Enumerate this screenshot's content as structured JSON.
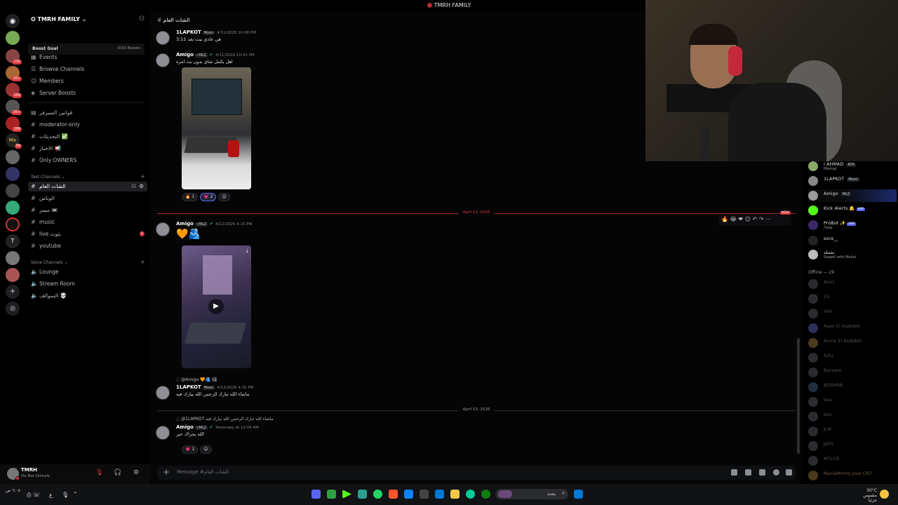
{
  "window": {
    "title": "TMRH FAMILY"
  },
  "server": {
    "name": "TMRH FAMILY",
    "boost_label": "Boost Goal",
    "boost_count": "0/33 Boosts",
    "rail_badges": [
      "130",
      "1K+",
      "100",
      "1K+",
      "108",
      "34"
    ],
    "rail_letters": [
      "Mx",
      "T"
    ]
  },
  "sidebar": {
    "top_items": [
      {
        "label": "Events",
        "icon": "calendar-icon"
      },
      {
        "label": "Browse Channels",
        "icon": "browse-icon"
      },
      {
        "label": "Members",
        "icon": "members-icon"
      },
      {
        "label": "Server Boosts",
        "icon": "boost-icon"
      }
    ],
    "channels_a": [
      {
        "label": "قوانين السيرفر",
        "icon": "rules-icon"
      },
      {
        "label": "moderator-only",
        "icon": "#"
      },
      {
        "label": "التحديثات ✅",
        "icon": "#"
      },
      {
        "label": "الاخبار 📢",
        "icon": "#"
      },
      {
        "label": "Only OWNERS",
        "icon": "#"
      }
    ],
    "text_category": "Text Channels",
    "text_channels": [
      {
        "label": "الشات العام",
        "icon": "#",
        "active": true
      },
      {
        "label": "الوناس",
        "icon": "#"
      },
      {
        "label": "ميمز 📼",
        "icon": "#"
      },
      {
        "label": "music",
        "icon": "#"
      },
      {
        "label": "live بثوث",
        "icon": "#",
        "unread": "1"
      },
      {
        "label": "youtube",
        "icon": "#"
      }
    ],
    "voice_category": "Voice Channels",
    "voice_channels": [
      {
        "label": "Lounge"
      },
      {
        "label": "Stream Room"
      },
      {
        "label": "السوالف 💀"
      }
    ]
  },
  "user_panel": {
    "name": "TMRH",
    "status": "Do Not Disturb"
  },
  "chat": {
    "channel_name": "الشات العام",
    "messages": [
      {
        "user": "1LAPKOT",
        "tag": "Moon",
        "time": "4/11/2026 10:08 PM",
        "text": "هي عادي يبت بعد 11;3"
      },
      {
        "user": "Amigo",
        "tag": "MLZ",
        "time": "4/11/2026 10:41 PM",
        "text": "اهل يكمل شاي بدون بث امره",
        "reactions": [
          {
            "emoji": "🔥",
            "count": "1"
          },
          {
            "emoji": "💗",
            "count": "2"
          }
        ]
      },
      {
        "user": "Amigo",
        "tag": "MLZ",
        "time": "4/12/2026 4:15 PM",
        "text": "🧡🫂"
      },
      {
        "reply_to": "@Amigo",
        "reply_text": "🧡🫂 🖼",
        "user": "1LAPKOT",
        "tag": "Moon",
        "time": "4/12/2026 4:31 PM",
        "text": "ماشاء الله تبارك الرحمن الله يبارك فيه"
      },
      {
        "reply_to": "@1LAPKOT",
        "reply_text": "ماشاء الله تبارك الرحمن الله يبارك فيه",
        "user": "Amigo",
        "tag": "MLZ",
        "time": "Yesterday at 12:04 AM",
        "text": "الله يجزاك خير",
        "reactions": [
          {
            "emoji": "💗",
            "count": "1"
          }
        ]
      }
    ],
    "dividers": [
      "April 12, 2026",
      "April 13, 2026"
    ],
    "new_label": "NEW",
    "composer_placeholder": "Message #الشات العام"
  },
  "members": {
    "online": [
      {
        "name": "I AHMAD",
        "tag": "RFA",
        "status": "Mazrog"
      },
      {
        "name": "1LAPKOT",
        "tag": "Moon"
      },
      {
        "name": "Amigo",
        "tag": "MLZ"
      },
      {
        "name": "Kick Alerts 🔔",
        "app": "APP"
      },
      {
        "name": "ProBot ✨",
        "app": "APP",
        "status": "/help"
      },
      {
        "name": "sora__"
      },
      {
        "name": "نجمله",
        "status": "SiegeX with Medal"
      }
    ],
    "offline_header": "Offline — 29",
    "offline": [
      "Aouz",
      "25",
      "VIH",
      "Aaso El Alabdeli",
      "Asma El Alabdeli",
      "AZiz",
      "Baraam",
      "BOSHRA",
      "bav",
      "bav",
      "JLM",
      "Jd5S",
      "M7LCR",
      "MariaMmmJ pow CR7"
    ]
  },
  "colors": {
    "accent": "#5865f2",
    "danger": "#da373c",
    "online": "#23a55a"
  },
  "taskbar": {
    "search": "بحث",
    "weather": "30°C",
    "weather_sub": "مشمس جزئياً",
    "lang": "ع"
  }
}
